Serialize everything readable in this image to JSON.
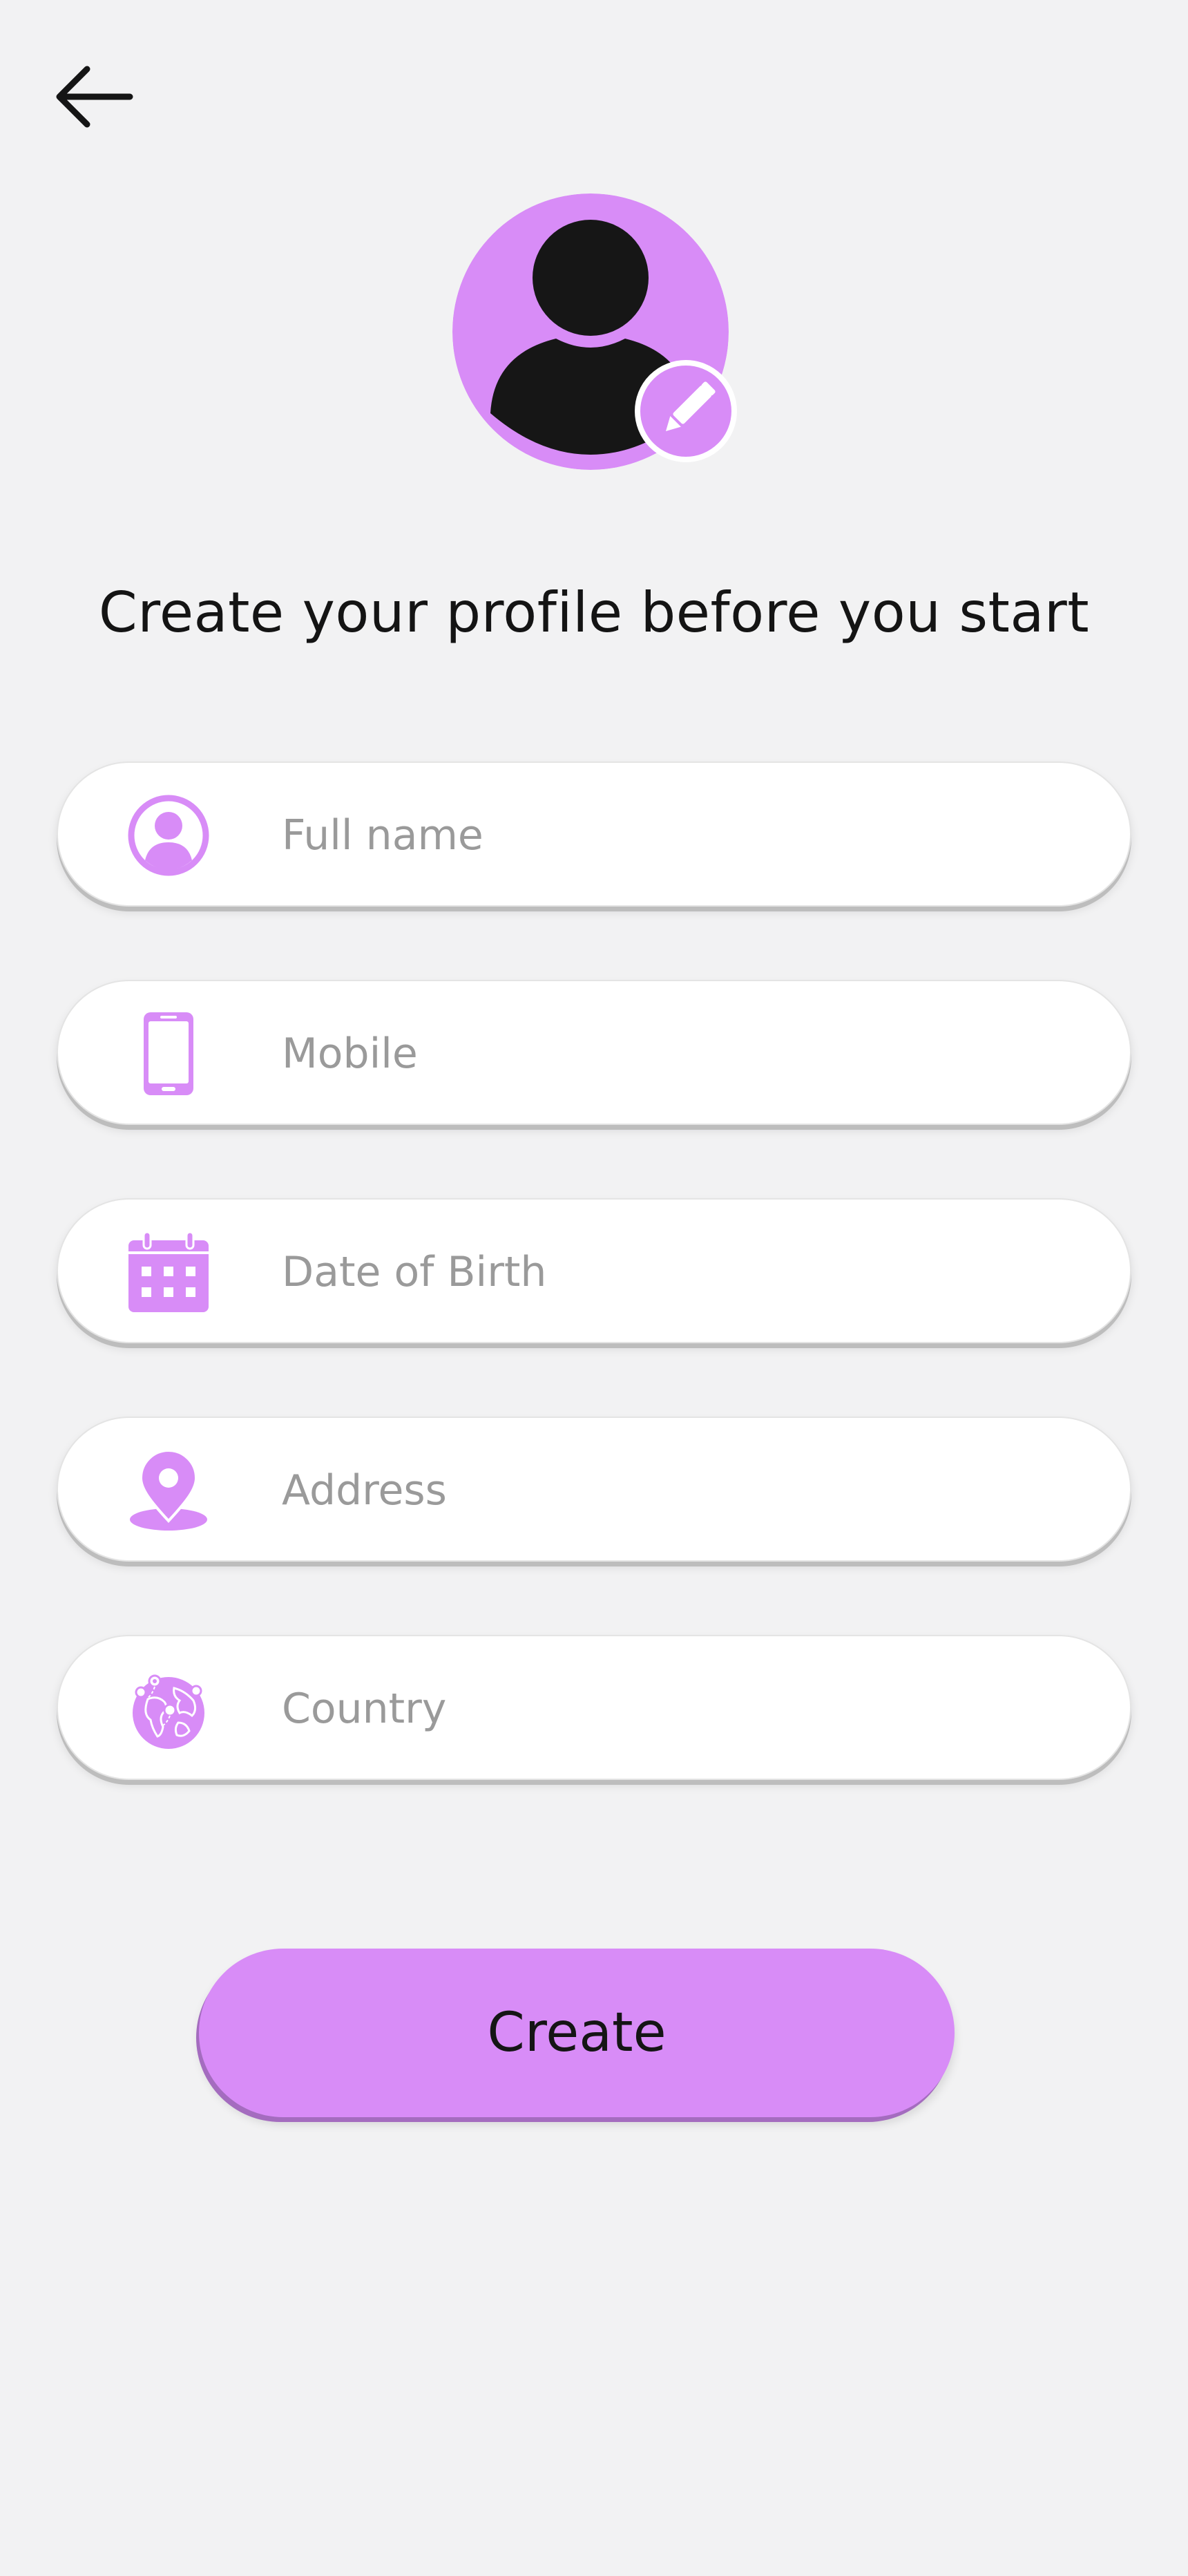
{
  "header": {
    "back_icon": "arrow-left-icon"
  },
  "profile": {
    "avatar_icon": "user-silhouette-icon",
    "edit_icon": "pencil-icon"
  },
  "title": "Create your profile before you start",
  "form": {
    "fields": [
      {
        "key": "full_name",
        "placeholder": "Full name",
        "value": "",
        "icon": "user-circle-icon"
      },
      {
        "key": "mobile",
        "placeholder": "Mobile",
        "value": "",
        "icon": "smartphone-icon"
      },
      {
        "key": "date_of_birth",
        "placeholder": "Date of Birth",
        "value": "",
        "icon": "calendar-icon"
      },
      {
        "key": "address",
        "placeholder": "Address",
        "value": "",
        "icon": "map-pin-icon"
      },
      {
        "key": "country",
        "placeholder": "Country",
        "value": "",
        "icon": "globe-icon"
      }
    ]
  },
  "actions": {
    "create_label": "Create"
  },
  "colors": {
    "accent": "#D88CF7",
    "accent_shadow": "#A46CBF",
    "background": "#F2F2F3",
    "text": "#141414",
    "placeholder": "#9A9A9A"
  }
}
